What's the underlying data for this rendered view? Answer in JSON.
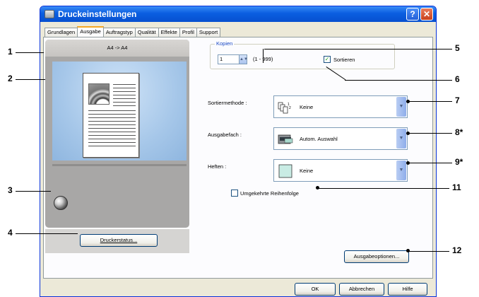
{
  "window": {
    "title": "Druckeinstellungen",
    "help": "?",
    "close": "✕"
  },
  "tabs": [
    "Grundlagen",
    "Ausgabe",
    "Auftragstyp",
    "Qualität",
    "Effekte",
    "Profil",
    "Support"
  ],
  "active_tab": "Ausgabe",
  "preview": {
    "paper_mapping": "A4 -> A4"
  },
  "buttons": {
    "printer_status": "Druckerstatus...",
    "output_options": "Ausgabeoptionen...",
    "ok": "OK",
    "cancel": "Abbrechen",
    "help": "Hilfe"
  },
  "copies": {
    "group_label": "Kopien",
    "value": "1",
    "range": "(1 - 999)",
    "collate_label": "Sortieren",
    "collate_checked": true
  },
  "sort_method": {
    "label": "Sortiermethode :",
    "value": "Keine"
  },
  "output_tray": {
    "label": "Ausgabefach :",
    "value": "Autom. Auswahl"
  },
  "staple": {
    "label": "Heften :",
    "value": "Keine"
  },
  "reverse_order": {
    "label": "Umgekehrte Reihenfolge",
    "checked": false
  },
  "callouts": [
    "1",
    "2",
    "3",
    "4",
    "5",
    "6",
    "7",
    "8*",
    "9*",
    "11",
    "12"
  ]
}
